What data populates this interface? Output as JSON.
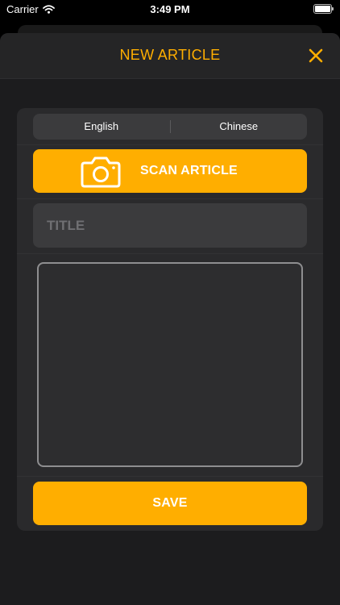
{
  "status_bar": {
    "carrier": "Carrier",
    "time": "3:49 PM"
  },
  "header": {
    "title": "NEW ARTICLE",
    "accent_color": "#ffae00",
    "close_icon": "close-icon"
  },
  "language_selector": {
    "options": [
      "English",
      "Chinese"
    ]
  },
  "scan_button": {
    "label": "SCAN ARTICLE",
    "icon": "camera-icon"
  },
  "title_field": {
    "placeholder": "TITLE",
    "value": ""
  },
  "content_field": {
    "value": ""
  },
  "save_button": {
    "label": "SAVE"
  }
}
